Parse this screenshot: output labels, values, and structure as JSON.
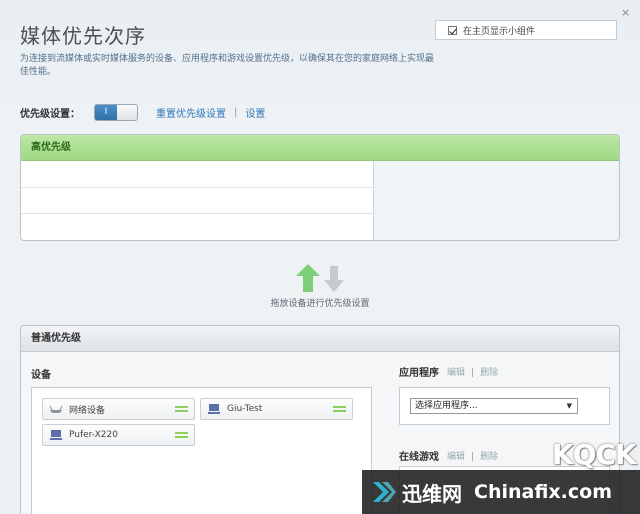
{
  "window": {
    "close_glyph": "×"
  },
  "header": {
    "title": "媒体优先次序",
    "description": "为连接到流媒体或实时媒体服务的设备、应用程序和游戏设置优先级，以确保其在您的家庭网络上实现最佳性能。",
    "show_widget_label": "在主页显示小组件",
    "show_widget_checked": true
  },
  "priority_setting": {
    "label": "优先级设置：",
    "toggle_on_label": "I",
    "toggle_state": "on",
    "reset_link": "重置优先级设置",
    "separator": "|",
    "settings_link": "设置"
  },
  "high_priority": {
    "title": "高优先级",
    "rows": [
      "",
      "",
      ""
    ]
  },
  "drag_hint": "拖放设备进行优先级设置",
  "normal_priority": {
    "title": "普通优先级",
    "devices_label": "设备",
    "devices": [
      {
        "name": "网络设备",
        "icon": "router-icon"
      },
      {
        "name": "Giu-Test",
        "icon": "computer-icon"
      },
      {
        "name": "Pufer-X220",
        "icon": "computer-icon"
      }
    ],
    "apps_label": "应用程序",
    "apps_edit": "编辑",
    "apps_delete": "删除",
    "apps_select": "选择应用程序...",
    "games_label": "在线游戏",
    "games_edit": "编辑",
    "games_delete": "删除"
  },
  "watermark": {
    "brand_cn": "迅维网",
    "brand_en": "Chinafix.com",
    "corner": "KQCK"
  },
  "colors": {
    "accent_green": "#9fd882",
    "link_blue": "#2f77b9",
    "toggle_blue": "#2e70a8"
  }
}
